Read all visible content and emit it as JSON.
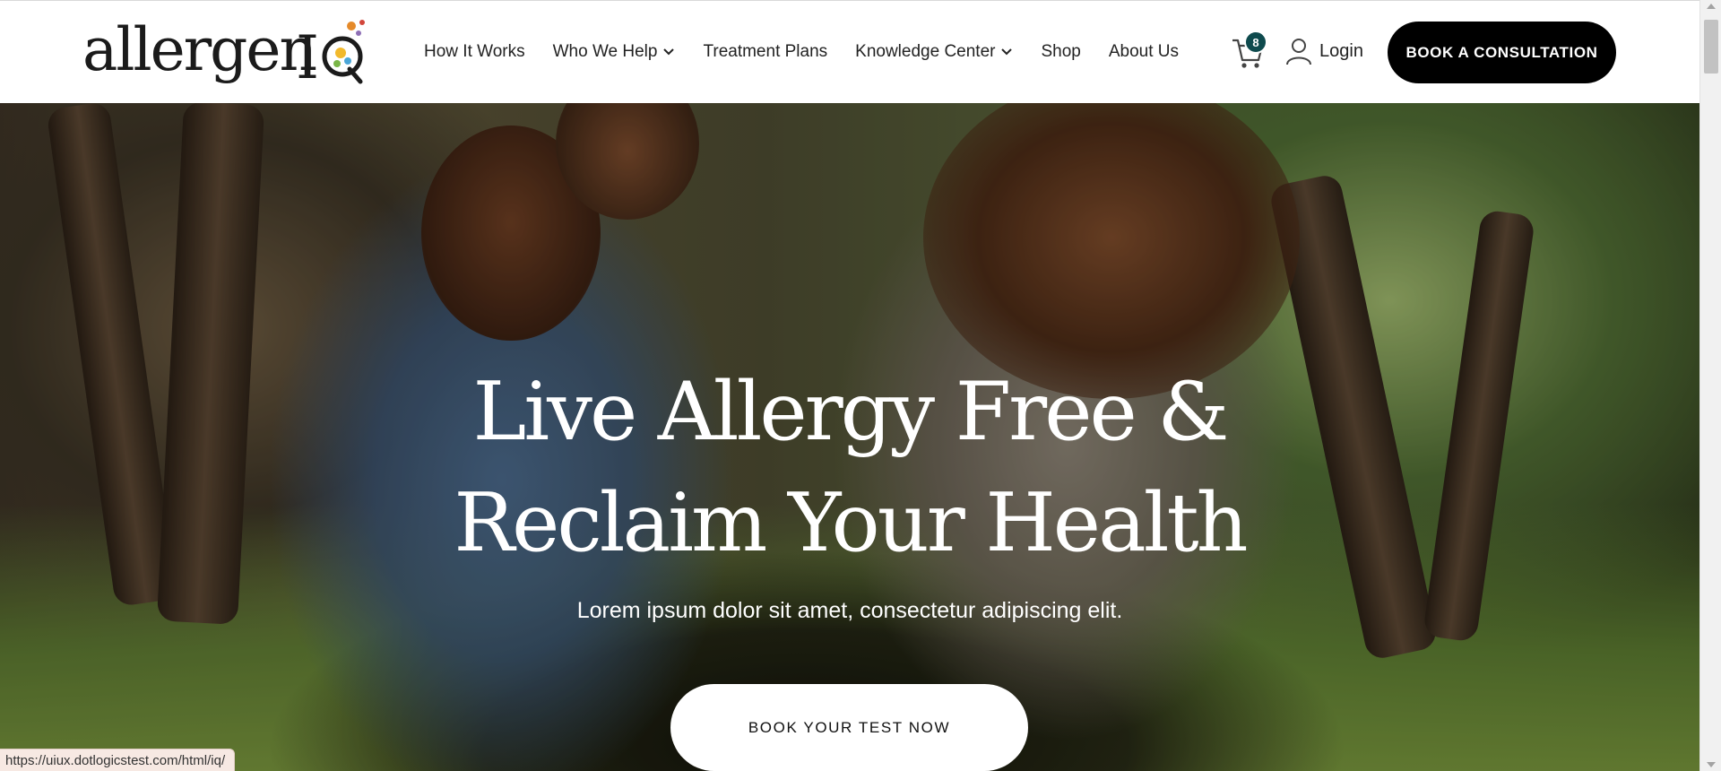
{
  "brand": {
    "name": "allergenIQ",
    "logo_text": "allergen",
    "logo_accent_colors": [
      "#e58a2a",
      "#f2b92c",
      "#4aa6d8",
      "#d2463b",
      "#7ab648",
      "#8e6fb5"
    ]
  },
  "nav": {
    "items": [
      {
        "label": "How It Works",
        "has_dropdown": false
      },
      {
        "label": "Who We Help",
        "has_dropdown": true
      },
      {
        "label": "Treatment Plans",
        "has_dropdown": false
      },
      {
        "label": "Knowledge Center",
        "has_dropdown": true
      },
      {
        "label": "Shop",
        "has_dropdown": false
      },
      {
        "label": "About Us",
        "has_dropdown": false
      }
    ]
  },
  "cart": {
    "icon": "shopping-cart-icon",
    "count": "8",
    "badge_color": "#0e4a4d"
  },
  "login": {
    "icon": "user-icon",
    "label": "Login"
  },
  "consult_button": {
    "label": "BOOK A CONSULTATION"
  },
  "hero": {
    "title_line1": "Live Allergy Free &",
    "title_line2": "Reclaim Your Health",
    "subtitle": "Lorem ipsum dolor sit amet, consectetur adipiscing elit.",
    "cta_label": "BOOK YOUR TEST NOW"
  },
  "status_bar": {
    "url": "https://uiux.dotlogicstest.com/html/iq/"
  }
}
